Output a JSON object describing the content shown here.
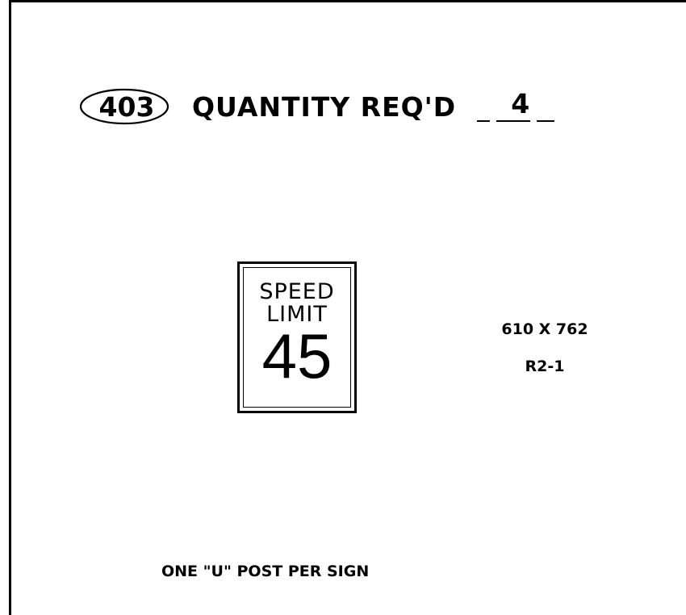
{
  "header": {
    "item_number": "403",
    "quantity_label": "QUANTITY REQ'D",
    "quantity_value": "4"
  },
  "sign": {
    "line1": "SPEED",
    "line2": "LIMIT",
    "number": "45"
  },
  "specs": {
    "size": "610 X 762",
    "code": "R2-1"
  },
  "note": "ONE \"U\" POST PER SIGN"
}
